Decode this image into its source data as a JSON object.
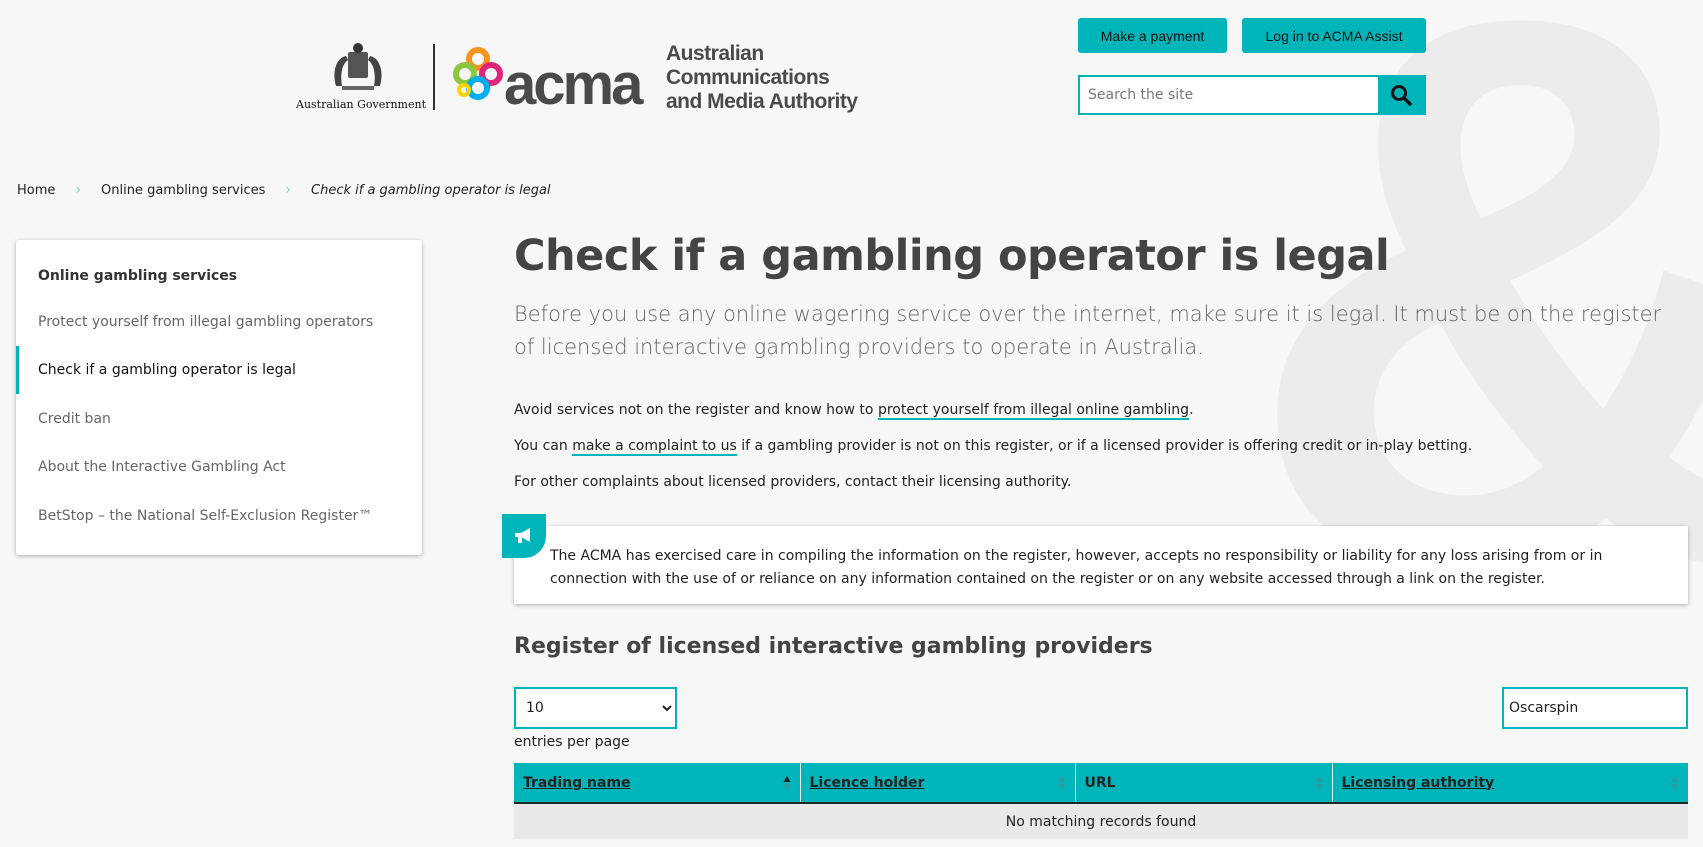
{
  "header": {
    "gov_logo_text": "Australian Government",
    "acma_wordmark": "acma",
    "org_name_lines": [
      "Australian",
      "Communications",
      "and Media Authority"
    ],
    "payment_button": "Make a payment",
    "login_button": "Log in to ACMA Assist",
    "search_placeholder": "Search the site",
    "search_icon": "magnifier-icon"
  },
  "breadcrumb": {
    "home": "Home",
    "parent": "Online gambling services",
    "current": "Check if a gambling operator is legal"
  },
  "sidebar": {
    "title": "Online gambling services",
    "items": [
      {
        "label": "Protect yourself from illegal gambling operators",
        "active": false
      },
      {
        "label": "Check if a gambling operator is legal",
        "active": true
      },
      {
        "label": "Credit ban",
        "active": false
      },
      {
        "label": "About the Interactive Gambling Act",
        "active": false
      },
      {
        "label": "BetStop – the National Self-Exclusion Register™",
        "active": false
      }
    ]
  },
  "main": {
    "title": "Check if a gambling operator is legal",
    "lead": "Before you use any online wagering service over the internet, make sure it is legal. It must be on the register of licensed interactive gambling providers to operate in Australia.",
    "para1_pre": "Avoid services not on the register and know how to ",
    "para1_link": "protect yourself from illegal online gambling",
    "para1_post": ".",
    "para2_pre": "You can ",
    "para2_link": "make a complaint to us",
    "para2_post": " if a gambling provider is not on this register, or if a licensed provider is offering credit or in-play betting.",
    "para3": "For other complaints about licensed providers, contact their licensing authority.",
    "notice": "The ACMA has exercised care in compiling the information on the register, however, accepts no responsibility or liability for any loss arising from or in connection with the use of or reliance on any information contained on the register or on any website accessed through a link on the register.",
    "notice_icon": "megaphone-icon",
    "register_title": "Register of licensed interactive gambling providers",
    "entries_value": "10",
    "entries_label": "entries per page",
    "filter_value": "Oscarspin"
  },
  "table": {
    "columns": [
      "Trading name",
      "Licence holder",
      "URL",
      "Licensing authority"
    ],
    "sorted_column": "Trading name",
    "empty_message": "No matching records found"
  },
  "colors": {
    "accent": "#00b5ba",
    "title_gray": "#444444",
    "background": "#f7f7f7"
  }
}
